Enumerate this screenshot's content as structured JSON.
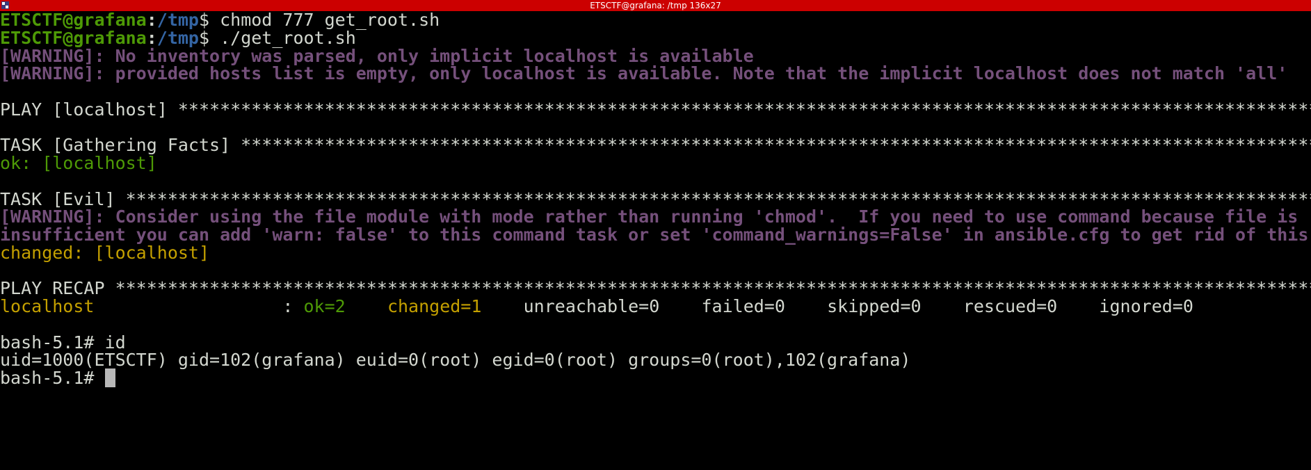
{
  "window": {
    "title": "ETSCTF@grafana: /tmp 136x27"
  },
  "colors": {
    "background": "#000000",
    "titlebar": "#cc0000",
    "default": "#d3d7cf",
    "prompt_user": "#4e9a06",
    "prompt_path": "#3465a4",
    "warning": "#75507b",
    "ok": "#4e9a06",
    "changed": "#c4a000",
    "cursor": "#b8b8b8"
  },
  "terminal": {
    "lines": [
      {
        "segments": [
          {
            "text": "ETSCTF@grafana",
            "color": "#4e9a06",
            "bold": true
          },
          {
            "text": ":",
            "color": "#d3d7cf",
            "bold": true
          },
          {
            "text": "/tmp",
            "color": "#3465a4",
            "bold": true
          },
          {
            "text": "$ chmod 777 get_root.sh",
            "color": "#d3d7cf",
            "bold": false
          }
        ]
      },
      {
        "segments": [
          {
            "text": "ETSCTF@grafana",
            "color": "#4e9a06",
            "bold": true
          },
          {
            "text": ":",
            "color": "#d3d7cf",
            "bold": true
          },
          {
            "text": "/tmp",
            "color": "#3465a4",
            "bold": true
          },
          {
            "text": "$ ./get_root.sh",
            "color": "#d3d7cf",
            "bold": false
          }
        ]
      },
      {
        "segments": [
          {
            "text": "[WARNING]: No inventory was parsed, only implicit localhost is available",
            "color": "#75507b",
            "bold": true
          }
        ]
      },
      {
        "segments": [
          {
            "text": "[WARNING]: provided hosts list is empty, only localhost is available. Note that the implicit localhost does not match 'all'",
            "color": "#75507b",
            "bold": true
          }
        ]
      },
      {
        "segments": []
      },
      {
        "segments": [
          {
            "text": "PLAY [localhost] *******************************************************************************************************************",
            "color": "#d3d7cf",
            "bold": false
          }
        ]
      },
      {
        "segments": []
      },
      {
        "segments": [
          {
            "text": "TASK [Gathering Facts] *************************************************************************************************************",
            "color": "#d3d7cf",
            "bold": false
          }
        ]
      },
      {
        "segments": [
          {
            "text": "ok: [localhost]",
            "color": "#4e9a06",
            "bold": false
          }
        ]
      },
      {
        "segments": []
      },
      {
        "segments": [
          {
            "text": "TASK [Evil] ************************************************************************************************************************",
            "color": "#d3d7cf",
            "bold": false
          }
        ]
      },
      {
        "segments": [
          {
            "text": "[WARNING]: Consider using the file module with mode rather than running 'chmod'.  If you need to use command because file is",
            "color": "#75507b",
            "bold": true
          }
        ]
      },
      {
        "segments": [
          {
            "text": "insufficient you can add 'warn: false' to this command task or set 'command_warnings=False' in ansible.cfg to get rid of this message.",
            "color": "#75507b",
            "bold": true
          }
        ]
      },
      {
        "segments": [
          {
            "text": "changed: [localhost]",
            "color": "#c4a000",
            "bold": false
          }
        ]
      },
      {
        "segments": []
      },
      {
        "segments": [
          {
            "text": "PLAY RECAP *************************************************************************************************************************",
            "color": "#d3d7cf",
            "bold": false
          }
        ]
      },
      {
        "segments": [
          {
            "text": "localhost",
            "color": "#c4a000",
            "bold": false
          },
          {
            "text": "                  : ",
            "color": "#d3d7cf",
            "bold": false
          },
          {
            "text": "ok=2",
            "color": "#4e9a06",
            "bold": false
          },
          {
            "text": "    ",
            "color": "#d3d7cf",
            "bold": false
          },
          {
            "text": "changed=1",
            "color": "#c4a000",
            "bold": false
          },
          {
            "text": "    unreachable=0    failed=0    skipped=0    rescued=0    ignored=0",
            "color": "#d3d7cf",
            "bold": false
          }
        ]
      },
      {
        "segments": []
      },
      {
        "segments": [
          {
            "text": "bash-5.1# id",
            "color": "#d3d7cf",
            "bold": false
          }
        ]
      },
      {
        "segments": [
          {
            "text": "uid=1000(ETSCTF) gid=102(grafana) euid=0(root) egid=0(root) groups=0(root),102(grafana)",
            "color": "#d3d7cf",
            "bold": false
          }
        ]
      },
      {
        "segments": [
          {
            "text": "bash-5.1# ",
            "color": "#d3d7cf",
            "bold": false
          }
        ],
        "cursor": true
      }
    ]
  }
}
